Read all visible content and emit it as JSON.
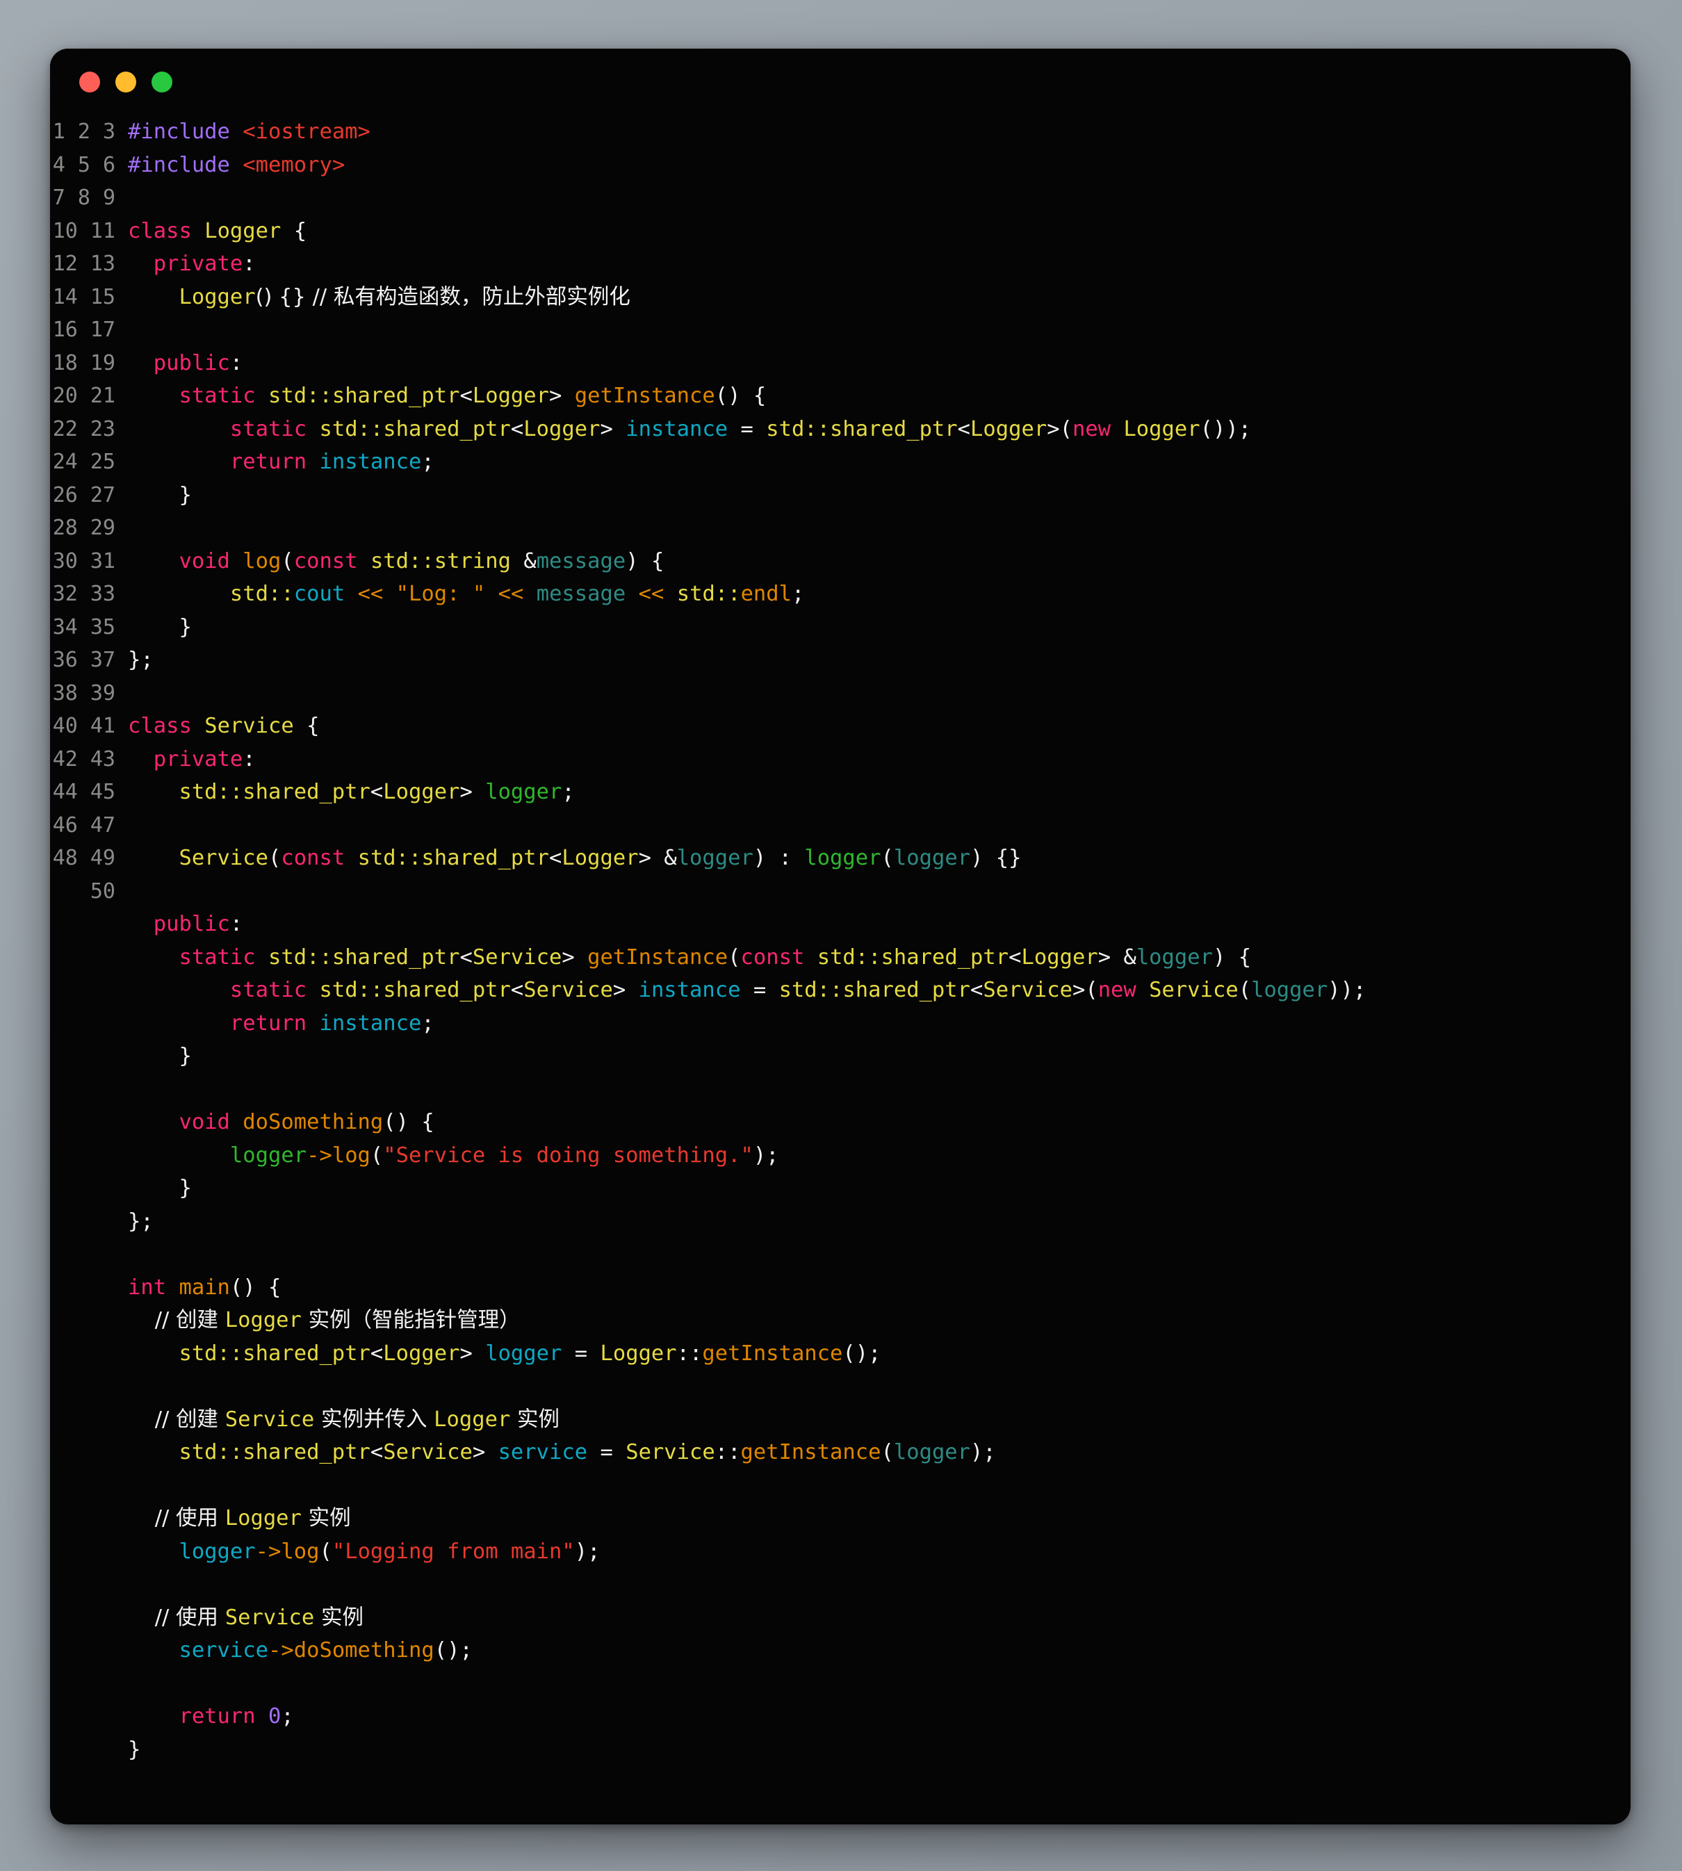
{
  "window": {
    "traffic_lights": [
      {
        "name": "close",
        "color": "#ff5f57"
      },
      {
        "name": "minimize",
        "color": "#febc2e"
      },
      {
        "name": "zoom",
        "color": "#28c840"
      }
    ],
    "background": "#050505",
    "language": "cpp"
  },
  "theme": {
    "preprocessor": "#a06ef7",
    "header": "#e8392e",
    "keyword": "#f92672",
    "type": "#e6db44",
    "function": "#e08600",
    "variable": "#0fa8c4",
    "parameter": "#2e8b85",
    "member": "#2fb82f",
    "string_red": "#e8392e",
    "string_orange": "#e08600",
    "comment": "#8a8a8a",
    "punctuation": "#f2f2f2",
    "gutter": "#8a8a8a"
  },
  "editor": {
    "first_line_number": 1,
    "last_line_number": 50,
    "total_lines": 50,
    "line_numbers": [
      1,
      2,
      3,
      4,
      5,
      6,
      7,
      8,
      9,
      10,
      11,
      12,
      13,
      14,
      15,
      16,
      17,
      18,
      19,
      20,
      21,
      22,
      23,
      24,
      25,
      26,
      27,
      28,
      29,
      30,
      31,
      32,
      33,
      34,
      35,
      36,
      37,
      38,
      39,
      40,
      41,
      42,
      43,
      44,
      45,
      46,
      47,
      48,
      49,
      50
    ],
    "lines": [
      "#include <iostream>",
      "#include <memory>",
      "",
      "class Logger {",
      "  private:",
      "    Logger() {} // 私有构造函数，防止外部实例化",
      "",
      "  public:",
      "    static std::shared_ptr<Logger> getInstance() {",
      "        static std::shared_ptr<Logger> instance = std::shared_ptr<Logger>(new Logger());",
      "        return instance;",
      "    }",
      "",
      "    void log(const std::string &message) {",
      "        std::cout << \"Log: \" << message << std::endl;",
      "    }",
      "};",
      "",
      "class Service {",
      "  private:",
      "    std::shared_ptr<Logger> logger;",
      "",
      "    Service(const std::shared_ptr<Logger> &logger) : logger(logger) {}",
      "",
      "  public:",
      "    static std::shared_ptr<Service> getInstance(const std::shared_ptr<Logger> &logger) {",
      "        static std::shared_ptr<Service> instance = std::shared_ptr<Service>(new Service(logger));",
      "        return instance;",
      "    }",
      "",
      "    void doSomething() {",
      "        logger->log(\"Service is doing something.\");",
      "    }",
      "};",
      "",
      "int main() {",
      "    // 创建 Logger 实例（智能指针管理）",
      "    std::shared_ptr<Logger> logger = Logger::getInstance();",
      "",
      "    // 创建 Service 实例并传入 Logger 实例",
      "    std::shared_ptr<Service> service = Service::getInstance(logger);",
      "",
      "    // 使用 Logger 实例",
      "    logger->log(\"Logging from main\");",
      "",
      "    // 使用 Service 实例",
      "    service->doSomething();",
      "",
      "    return 0;",
      "}"
    ],
    "comments": [
      "// 私有构造函数，防止外部实例化",
      "// 创建 Logger 实例（智能指针管理）",
      "// 创建 Service 实例并传入 Logger 实例",
      "// 使用 Logger 实例",
      "// 使用 Service 实例"
    ],
    "strings": [
      "\"Log: \"",
      "\"Service is doing something.\"",
      "\"Logging from main\""
    ],
    "identifiers": {
      "classes": [
        "Logger",
        "Service"
      ],
      "functions": [
        "getInstance",
        "log",
        "doSomething",
        "main"
      ],
      "variables": [
        "instance",
        "logger",
        "service",
        "message"
      ],
      "headers": [
        "<iostream>",
        "<memory>"
      ]
    }
  }
}
